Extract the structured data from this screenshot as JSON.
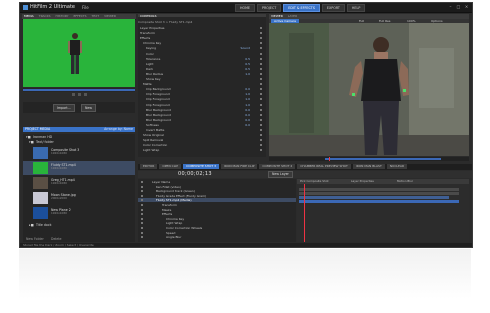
{
  "app": {
    "title": "HitFilm 2 Ultimate",
    "file_menu": "File"
  },
  "top_tabs": [
    "HOME",
    "PROJECT",
    "EDIT & EFFECTS",
    "EXPORT",
    "HELP"
  ],
  "active_top_tab": "EDIT & EFFECTS",
  "left_panel": {
    "tabs": [
      "MEDIA",
      "TRACKS",
      "HISTORY",
      "EFFECTS",
      "TEXT",
      "VIEWER"
    ],
    "import_button": "Import...",
    "new_button": "New",
    "project_media_title": "PROJECT MEDIA",
    "arrange_label": "Arrange by: Name",
    "folders": [
      "Ironman HD",
      "Text/ folder"
    ],
    "items": [
      {
        "name": "Composite Shot 3",
        "sub": "1920x1080"
      },
      {
        "name": "Fluidy ST1.mp4",
        "sub": "1920x1080"
      },
      {
        "name": "Greg_HT1.mp4",
        "sub": "1920x1080"
      },
      {
        "name": "Moon Stone.jpg",
        "sub": "2000x2000"
      },
      {
        "name": "New Plane 2",
        "sub": "1920x1080"
      }
    ],
    "folder_bottom": "Title dock",
    "footer": [
      "New Folder",
      "Delete"
    ]
  },
  "controls": {
    "title": "CONTROLS",
    "subtitle": "Composite Shot 3 > Fluidy ST1.mp4",
    "rows": [
      {
        "label": "Layer Properties",
        "value": ""
      },
      {
        "label": "Transform",
        "value": ""
      },
      {
        "label": "Effects",
        "value": ""
      },
      {
        "label": "Chroma Key",
        "value": ""
      },
      {
        "label": "Keying",
        "value": "Sound"
      },
      {
        "label": "Color",
        "value": ""
      },
      {
        "label": "Tolerance",
        "value": "0.5"
      },
      {
        "label": "Light",
        "value": "0.5"
      },
      {
        "label": "Dark",
        "value": "0.5"
      },
      {
        "label": "Blur Radius",
        "value": "1.0"
      },
      {
        "label": "Show Key",
        "value": ""
      },
      {
        "label": "Matte",
        "value": ""
      },
      {
        "label": "Clip Background",
        "value": "0.0"
      },
      {
        "label": "Clip Foreground",
        "value": "1.0"
      },
      {
        "label": "Clip Foreground",
        "value": "1.0"
      },
      {
        "label": "Clip Foreground",
        "value": "1.0"
      },
      {
        "label": "Blur Background",
        "value": "0.0"
      },
      {
        "label": "Blur Background",
        "value": "0.0"
      },
      {
        "label": "Blur Background",
        "value": "0.0"
      },
      {
        "label": "Softness",
        "value": "0.0"
      },
      {
        "label": "Invert Matte",
        "value": ""
      },
      {
        "label": "Show Original",
        "value": ""
      },
      {
        "label": "Spill Removal",
        "value": ""
      },
      {
        "label": "Color Correction",
        "value": ""
      },
      {
        "label": "Light Wrap",
        "value": ""
      }
    ]
  },
  "viewer": {
    "tabs": [
      "VIEWER",
      "LAYER"
    ],
    "toolbar": [
      "Full",
      "Full Res",
      "100%",
      "Options"
    ],
    "label": "Active Camera"
  },
  "editor": {
    "tabs": [
      "EDITOR",
      "OPEN CLIP",
      "COMPOSITE SHOT 3",
      "IRON MAN FIRE CLIP",
      "COMPOSITE SHOT 2",
      "CHAMBER REAL PREVIEW SHOT",
      "IRON MAN BLAST",
      "NUCLEAR"
    ],
    "active_tab": "COMPOSITE SHOT 3",
    "timecode": "00;00;02;13",
    "new_layer": "New Layer",
    "ruler_labels": [
      "Pick Composite Shot",
      "Layer Properties",
      "Motion Blur"
    ],
    "layers": [
      "Layer Name",
      "Ken Fillet (video)",
      "Background track (Green)",
      "Fluidy Grade Effect (Fluidy Gram)",
      "Fluidy ST1.mp4 (Media)",
      "Transform",
      "Masks",
      "Effects",
      "Chroma Key",
      "Light Wrap",
      "Color Correction Wheels",
      "Speed",
      "Angle Blur"
    ],
    "selected_layer": "Fluidy ST1.mp4 (Media)"
  },
  "statusbar": "Stored file the Dark / Zoom / Select / Overwrite"
}
